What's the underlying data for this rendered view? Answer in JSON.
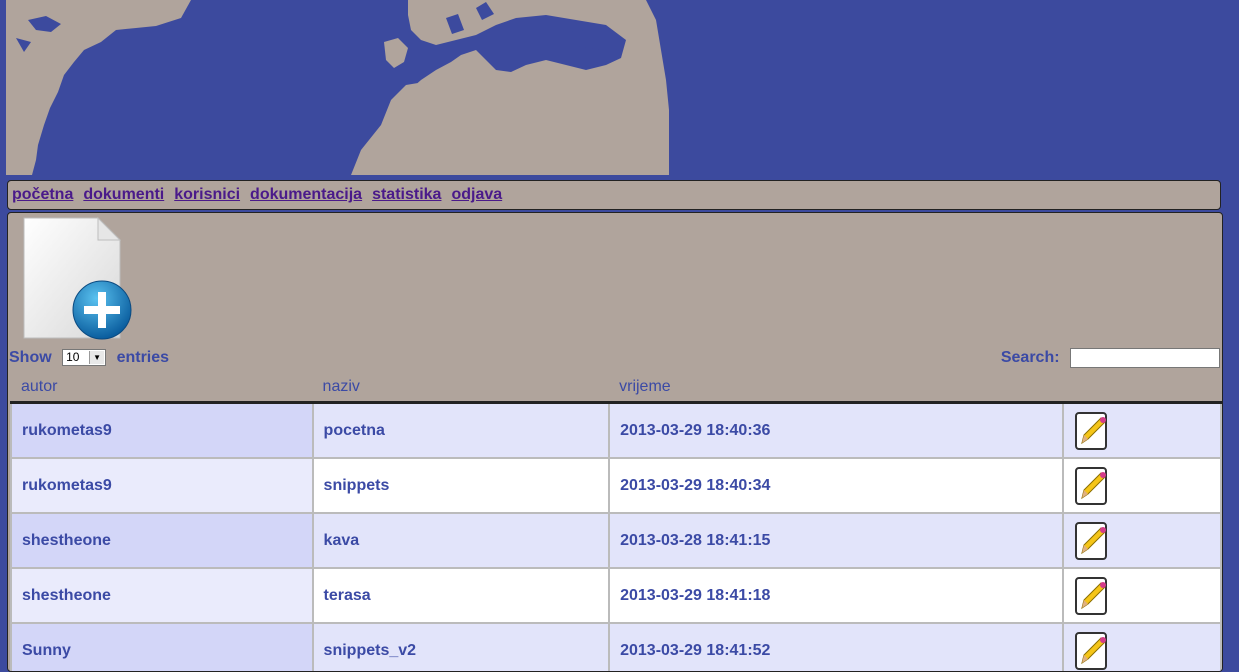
{
  "nav": {
    "items": [
      "početna",
      "dokumenti",
      "korisnici",
      "dokumentacija",
      "statistika",
      "odjava"
    ]
  },
  "toolbar": {
    "new_document_icon": "new-document-plus-icon"
  },
  "table_controls": {
    "show_label": "Show",
    "page_length": "10",
    "entries_label": "entries",
    "search_label": "Search:",
    "search_value": ""
  },
  "table": {
    "columns": [
      "autor",
      "naziv",
      "vrijeme",
      ""
    ],
    "rows": [
      {
        "autor": "rukometas9",
        "naziv": "pocetna",
        "vrijeme": "2013-03-29 18:40:36"
      },
      {
        "autor": "rukometas9",
        "naziv": "snippets",
        "vrijeme": "2013-03-29 18:40:34"
      },
      {
        "autor": "shestheone",
        "naziv": "kava",
        "vrijeme": "2013-03-28 18:41:15"
      },
      {
        "autor": "shestheone",
        "naziv": "terasa",
        "vrijeme": "2013-03-29 18:41:18"
      },
      {
        "autor": "Sunny",
        "naziv": "snippets_v2",
        "vrijeme": "2013-03-29 18:41:52"
      }
    ],
    "row_action_icon": "edit-pencil-icon"
  },
  "colors": {
    "background": "#3c4a9e",
    "panel": "#b0a49c",
    "text": "#3b4aa5",
    "link": "#4a1a8a"
  }
}
